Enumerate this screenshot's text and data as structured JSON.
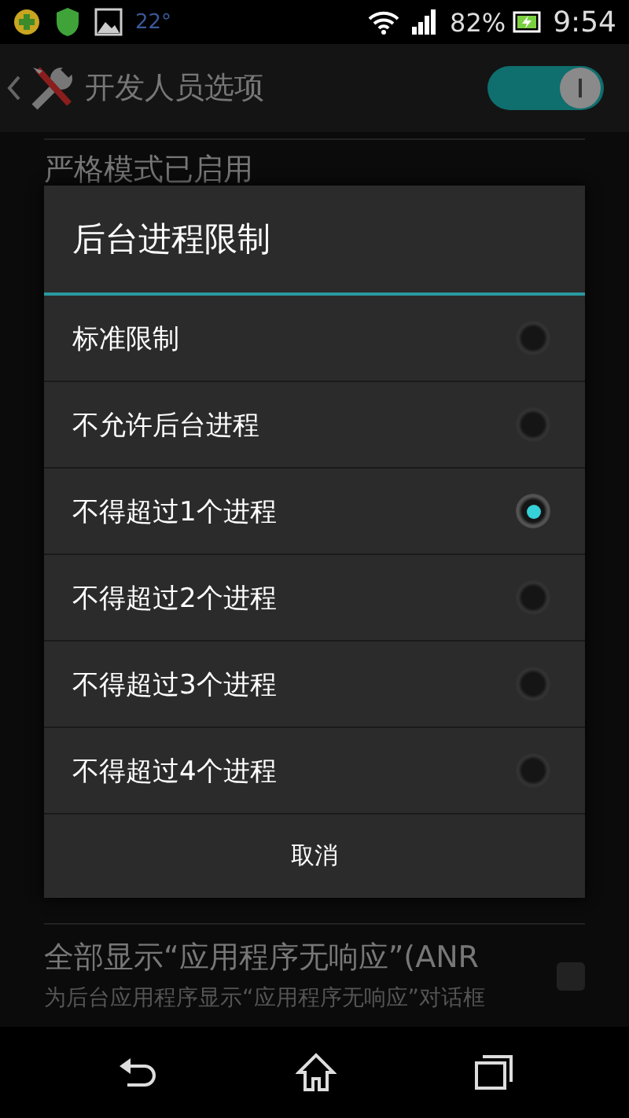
{
  "status_bar": {
    "temperature": "22°",
    "battery": "82%",
    "time": "9:54"
  },
  "action_bar": {
    "title": "开发人员选项",
    "master_switch": {
      "on": true
    }
  },
  "settings": [
    {
      "title": "严格模式已启用"
    },
    {
      "title": "全部显示“应用程序无响应”(ANR",
      "summary": "为后台应用程序显示“应用程序无响应”对话框",
      "checked": false
    }
  ],
  "dialog": {
    "title": "后台进程限制",
    "options": [
      {
        "label": "标准限制",
        "selected": false
      },
      {
        "label": "不允许后台进程",
        "selected": false
      },
      {
        "label": "不得超过1个进程",
        "selected": true
      },
      {
        "label": "不得超过2个进程",
        "selected": false
      },
      {
        "label": "不得超过3个进程",
        "selected": false
      },
      {
        "label": "不得超过4个进程",
        "selected": false
      }
    ],
    "cancel": "取消"
  }
}
